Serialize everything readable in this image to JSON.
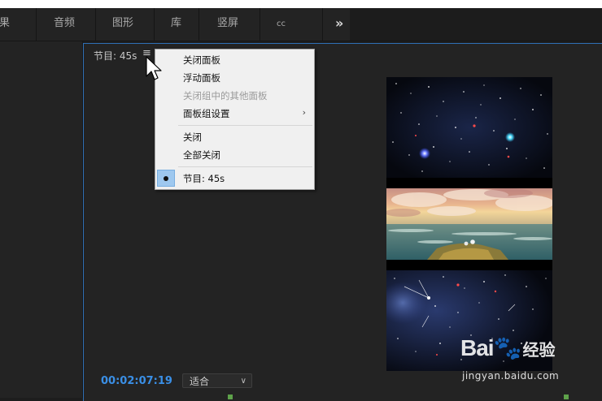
{
  "tabs": [
    {
      "label": "效果",
      "partial": "效果"
    },
    {
      "label": "音频"
    },
    {
      "label": "图形"
    },
    {
      "label": "库"
    },
    {
      "label": "竖屏"
    },
    {
      "label": "cc"
    }
  ],
  "overflow_label": "»",
  "program_panel": {
    "title": "节目: 45s",
    "timecode": "00:02:07:19",
    "fit_value": "适合"
  },
  "context_menu": {
    "items": [
      {
        "label": "关闭面板",
        "enabled": true
      },
      {
        "label": "浮动面板",
        "enabled": true
      },
      {
        "label": "关闭组中的其他面板",
        "enabled": false
      },
      {
        "label": "面板组设置",
        "enabled": true,
        "submenu": true
      },
      {
        "label": "关闭",
        "enabled": true
      },
      {
        "label": "全部关闭",
        "enabled": true
      },
      {
        "label": "节目: 45s",
        "enabled": true,
        "checked": true
      }
    ]
  },
  "watermark": {
    "logo": "Bai",
    "logo_suffix": "经验",
    "url": "jingyan.baidu.com"
  },
  "colors": {
    "accent_blue": "#3a8fe6",
    "panel_border": "#2f6fb4",
    "menu_bg": "#f0f0f0",
    "marker_green": "#5ea24a"
  }
}
